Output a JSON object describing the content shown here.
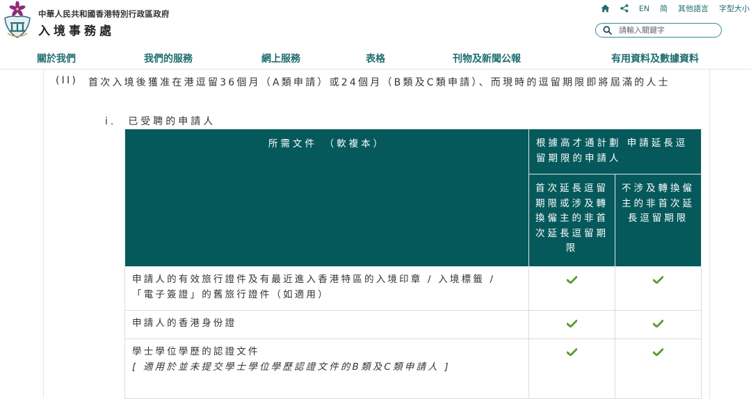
{
  "header": {
    "gov_name": "中華人民共和國香港特別行政區政府",
    "dept_name": "入境事務處",
    "top_links": {
      "home_icon": "home-icon",
      "share_icon": "share-icon",
      "lang_en": "EN",
      "lang_sc": "简",
      "other_lang": "其他語言",
      "font_size": "字型大小"
    },
    "search": {
      "placeholder": "請輸入關鍵字",
      "icon": "search-icon"
    }
  },
  "nav": {
    "items": [
      {
        "label": "關於我們"
      },
      {
        "label": "我們的服務"
      },
      {
        "label": "網上服務"
      },
      {
        "label": "表格"
      },
      {
        "label": "刊物及新聞公報"
      },
      {
        "label": "有用資料及數據資料"
      }
    ]
  },
  "content": {
    "section_label": "(II)",
    "section_text": "首次入境後獲准在港逗留36個月（A類申請）或24個月（B類及C類申請）、而現時的逗留期限即將屆滿的人士",
    "sub_label": "i.",
    "sub_text": "已受聘的申請人",
    "table": {
      "header_docs": "所需文件　（軟複本）",
      "header_group": "根據高才通計劃 申請延長逗留期限的申請人",
      "header_col1": "首次延長逗留期限或涉及轉換僱主的非首次延長逗留期限",
      "header_col2": "不涉及轉換僱主的非首次延長逗留期限",
      "check_icon": "checkmark-icon",
      "check_color": "#5a9e32",
      "header_color": "#06595b",
      "rows": [
        {
          "doc": "申請人的有效旅行證件及有最近進入香港特區的入境印章 / 入境標籤 / 「電子簽證」的舊旅行證件（如適用）",
          "note": "",
          "col1": true,
          "col2": true
        },
        {
          "doc": "申請人的香港身份證",
          "note": "",
          "col1": true,
          "col2": true
        },
        {
          "doc": "學士學位學歷的認證文件",
          "note": "[ 適用於並未提交學士學位學歷認證文件的B類及C類申請人 ]",
          "col1": true,
          "col2": true
        }
      ]
    }
  }
}
